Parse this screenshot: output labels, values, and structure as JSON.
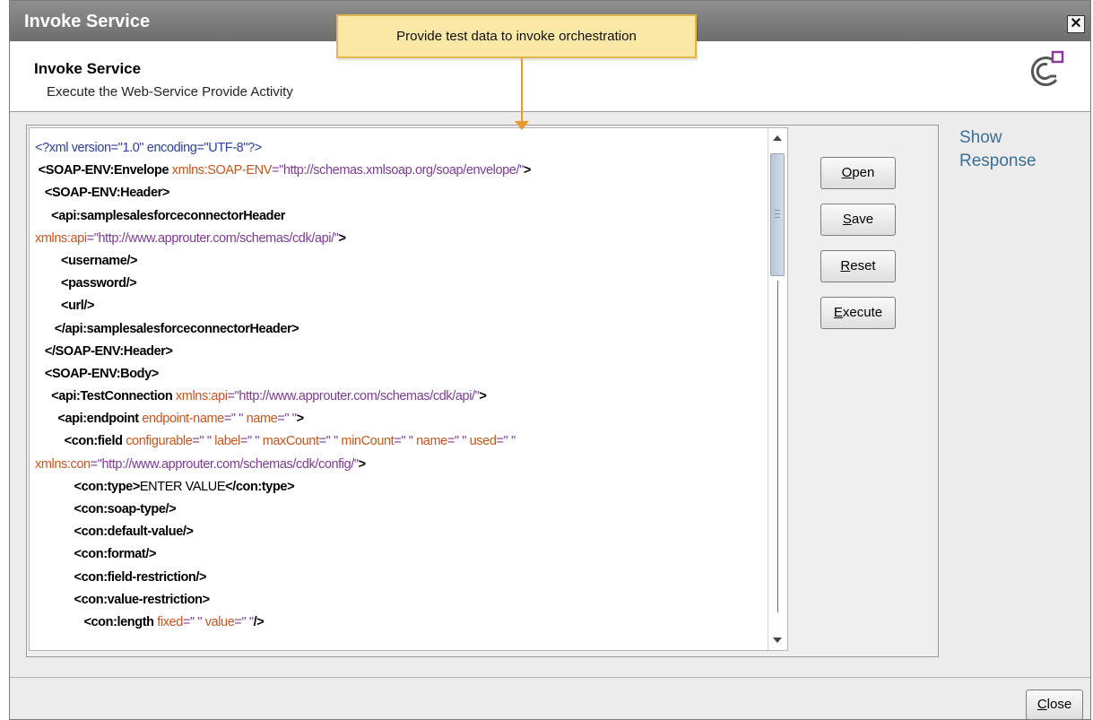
{
  "window": {
    "title": "Invoke Service",
    "close_glyph": "✕"
  },
  "header": {
    "title": "Invoke Service",
    "subtitle": "Execute the Web-Service Provide Activity",
    "logo_icon": "service-logo-icon"
  },
  "tooltip": {
    "text": "Provide test data to invoke orchestration"
  },
  "buttons": {
    "open": "Open",
    "save": "Save",
    "reset": "Reset",
    "execute": "Execute"
  },
  "show_response": "Show Response",
  "footer": {
    "close": "Close"
  },
  "colors": {
    "tag": "#000000",
    "attribute": "#c2551f",
    "value": "#7d3b93",
    "declaration": "#2b3f98",
    "link": "#3d6f95",
    "callout_bg": "#fbe7a6"
  },
  "xml_lines": [
    {
      "indent": "",
      "parts": [
        {
          "t": "pi",
          "s": "<?xml version=\"1.0\" encoding=\"UTF-8\"?>"
        }
      ]
    },
    {
      "indent": " ",
      "parts": [
        {
          "t": "tag",
          "s": "<SOAP-ENV:Envelope"
        },
        {
          "t": "attr",
          "s": " xmlns:SOAP-ENV"
        },
        {
          "t": "val",
          "s": "=\"http://schemas.xmlsoap.org/soap/envelope/\""
        },
        {
          "t": "tag",
          "s": ">"
        }
      ]
    },
    {
      "indent": "   ",
      "parts": [
        {
          "t": "tag",
          "s": "<SOAP-ENV:Header>"
        }
      ]
    },
    {
      "indent": "     ",
      "parts": [
        {
          "t": "tag",
          "s": "<api:samplesalesforceconnectorHeader"
        }
      ]
    },
    {
      "indent": "",
      "parts": [
        {
          "t": "attr",
          "s": "xmlns:api"
        },
        {
          "t": "val",
          "s": "=\"http://www.approuter.com/schemas/cdk/api/\""
        },
        {
          "t": "tag",
          "s": ">"
        }
      ]
    },
    {
      "indent": "        ",
      "parts": [
        {
          "t": "tag",
          "s": "<username/>"
        }
      ]
    },
    {
      "indent": "        ",
      "parts": [
        {
          "t": "tag",
          "s": "<password/>"
        }
      ]
    },
    {
      "indent": "        ",
      "parts": [
        {
          "t": "tag",
          "s": "<url/>"
        }
      ]
    },
    {
      "indent": "      ",
      "parts": [
        {
          "t": "tag",
          "s": "</api:samplesalesforceconnectorHeader>"
        }
      ]
    },
    {
      "indent": "   ",
      "parts": [
        {
          "t": "tag",
          "s": "</SOAP-ENV:Header>"
        }
      ]
    },
    {
      "indent": "   ",
      "parts": [
        {
          "t": "tag",
          "s": "<SOAP-ENV:Body>"
        }
      ]
    },
    {
      "indent": "     ",
      "parts": [
        {
          "t": "tag",
          "s": "<api:TestConnection"
        },
        {
          "t": "attr",
          "s": " xmlns:api"
        },
        {
          "t": "val",
          "s": "=\"http://www.approuter.com/schemas/cdk/api/\""
        },
        {
          "t": "tag",
          "s": ">"
        }
      ]
    },
    {
      "indent": "       ",
      "parts": [
        {
          "t": "tag",
          "s": "<api:endpoint"
        },
        {
          "t": "attr",
          "s": " endpoint-name"
        },
        {
          "t": "val",
          "s": "=\" \""
        },
        {
          "t": "attr",
          "s": " name"
        },
        {
          "t": "val",
          "s": "=\" \""
        },
        {
          "t": "tag",
          "s": ">"
        }
      ]
    },
    {
      "indent": "         ",
      "parts": [
        {
          "t": "tag",
          "s": "<con:field"
        },
        {
          "t": "attr",
          "s": " configurable"
        },
        {
          "t": "val",
          "s": "=\" \""
        },
        {
          "t": "attr",
          "s": " label"
        },
        {
          "t": "val",
          "s": "=\" \""
        },
        {
          "t": "attr",
          "s": " maxCount"
        },
        {
          "t": "val",
          "s": "=\" \""
        },
        {
          "t": "attr",
          "s": " minCount"
        },
        {
          "t": "val",
          "s": "=\" \""
        },
        {
          "t": "attr",
          "s": " name"
        },
        {
          "t": "val",
          "s": "=\" \""
        },
        {
          "t": "attr",
          "s": " used"
        },
        {
          "t": "val",
          "s": "=\" \""
        }
      ]
    },
    {
      "indent": "",
      "parts": [
        {
          "t": "attr",
          "s": "xmlns:con"
        },
        {
          "t": "val",
          "s": "=\"http://www.approuter.com/schemas/cdk/config/\""
        },
        {
          "t": "tag",
          "s": ">"
        }
      ]
    },
    {
      "indent": "            ",
      "parts": [
        {
          "t": "tag",
          "s": "<con:type>"
        },
        {
          "t": "txt",
          "s": "ENTER VALUE"
        },
        {
          "t": "tag",
          "s": "</con:type>"
        }
      ]
    },
    {
      "indent": "            ",
      "parts": [
        {
          "t": "tag",
          "s": "<con:soap-type/>"
        }
      ]
    },
    {
      "indent": "            ",
      "parts": [
        {
          "t": "tag",
          "s": "<con:default-value/>"
        }
      ]
    },
    {
      "indent": "            ",
      "parts": [
        {
          "t": "tag",
          "s": "<con:format/>"
        }
      ]
    },
    {
      "indent": "            ",
      "parts": [
        {
          "t": "tag",
          "s": "<con:field-restriction/>"
        }
      ]
    },
    {
      "indent": "            ",
      "parts": [
        {
          "t": "tag",
          "s": "<con:value-restriction>"
        }
      ]
    },
    {
      "indent": "               ",
      "parts": [
        {
          "t": "tag",
          "s": "<con:length"
        },
        {
          "t": "attr",
          "s": " fixed"
        },
        {
          "t": "val",
          "s": "=\" \""
        },
        {
          "t": "attr",
          "s": " value"
        },
        {
          "t": "val",
          "s": "=\" \""
        },
        {
          "t": "tag",
          "s": "/>"
        }
      ]
    }
  ]
}
